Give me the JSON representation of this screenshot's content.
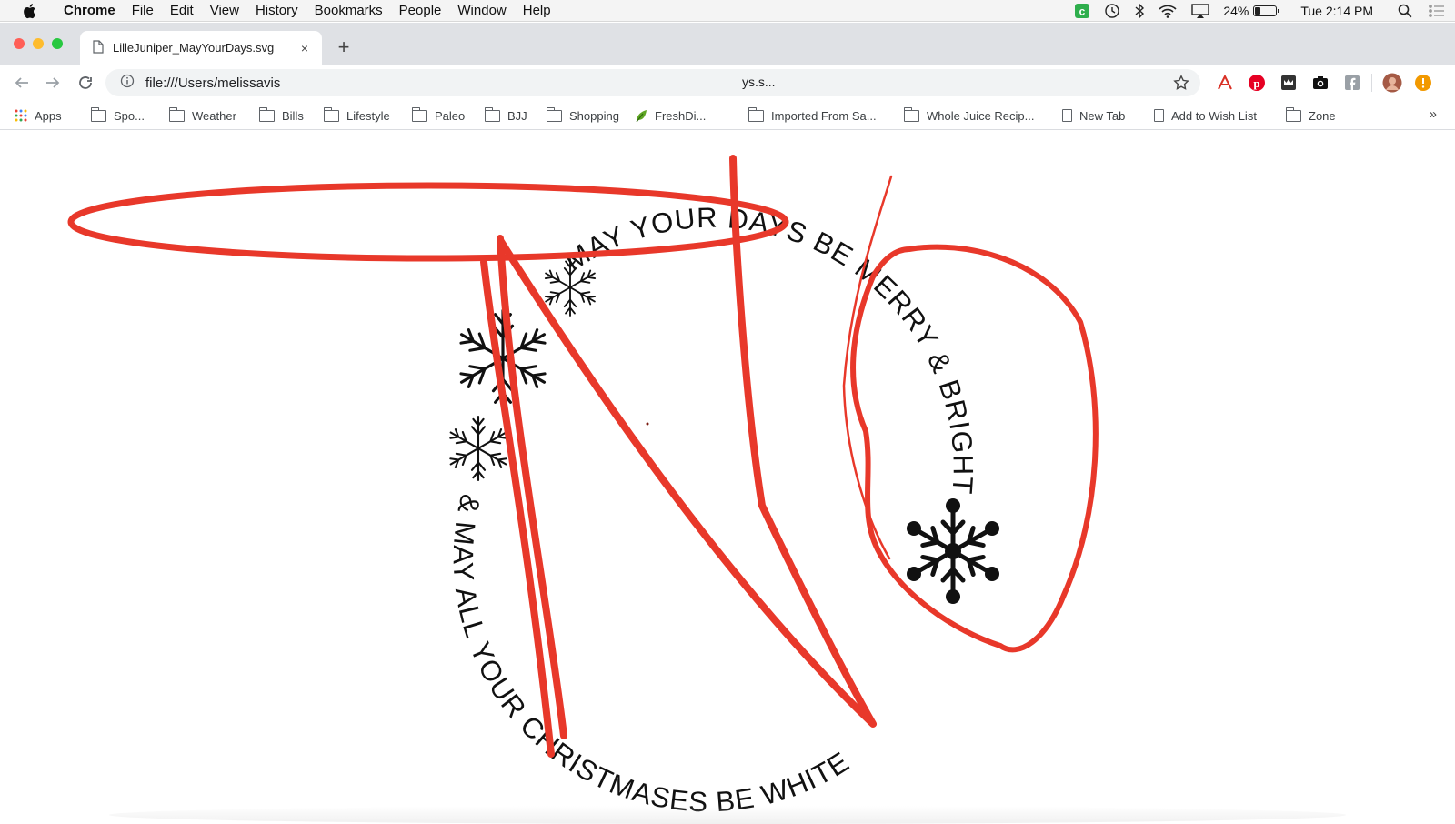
{
  "menubar": {
    "app_name": "Chrome",
    "items": [
      "File",
      "Edit",
      "View",
      "History",
      "Bookmarks",
      "People",
      "Window",
      "Help"
    ],
    "battery_percent": "24%",
    "battery_level": 0.24,
    "clock": "Tue 2:14 PM"
  },
  "tab": {
    "title": "LilleJuniper_MayYourDays.svg",
    "close_glyph": "×",
    "new_tab_glyph": "+"
  },
  "toolbar": {
    "url": "file:///Users/melissavis",
    "url_tail": "ys.s..."
  },
  "bookmarks": {
    "items": [
      {
        "label": "Apps",
        "icon": "apps-grid-icon"
      },
      {
        "label": "Spo...",
        "icon": "folder-icon"
      },
      {
        "label": "Weather",
        "icon": "folder-icon"
      },
      {
        "label": "Bills",
        "icon": "folder-icon"
      },
      {
        "label": "Lifestyle",
        "icon": "folder-icon"
      },
      {
        "label": "Paleo",
        "icon": "folder-icon"
      },
      {
        "label": "BJJ",
        "icon": "folder-icon"
      },
      {
        "label": "Shopping",
        "icon": "folder-icon"
      },
      {
        "label": "FreshDi...",
        "icon": "leaf-icon"
      },
      {
        "label": "Imported From Sa...",
        "icon": "folder-icon"
      },
      {
        "label": "Whole Juice Recip...",
        "icon": "folder-icon"
      },
      {
        "label": "New Tab",
        "icon": "page-icon"
      },
      {
        "label": "Add to Wish List",
        "icon": "page-icon"
      },
      {
        "label": "Zone",
        "icon": "folder-icon"
      }
    ],
    "overflow_glyph": "»"
  },
  "artwork": {
    "arc_text_top": "MAY YOUR DAYS BE MERRY & BRIGHT",
    "arc_text_bottom": "& MAY ALL YOUR CHRISTMASES BE WHITE",
    "ink_color": "#111111",
    "markup_color": "#e8382a"
  },
  "colors": {
    "close": "#ff5f57",
    "minimize": "#febc2e",
    "zoom": "#28c840",
    "markup": "#e8382a"
  }
}
